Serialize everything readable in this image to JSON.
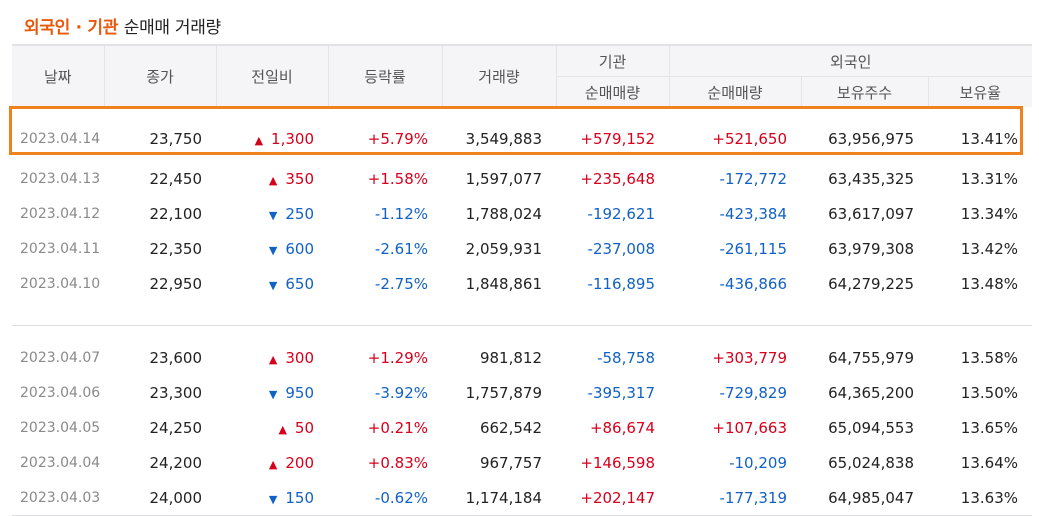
{
  "title": {
    "part1": "외국인 · 기관",
    "part2": "순매매 거래량"
  },
  "headers": {
    "date": "날짜",
    "close": "종가",
    "change": "전일비",
    "rate": "등락률",
    "volume": "거래량",
    "inst_group": "기관",
    "inst_net": "순매매량",
    "foreign_group": "외국인",
    "foreign_net": "순매매량",
    "foreign_hold": "보유주수",
    "foreign_ratio": "보유율"
  },
  "rows": [
    {
      "date": "2023.04.14",
      "close": "23,750",
      "dir": "up",
      "change": "1,300",
      "rate": "+5.79%",
      "volume": "3,549,883",
      "inst": "+579,152",
      "foreign": "+521,650",
      "hold": "63,956,975",
      "ratio": "13.41%"
    },
    {
      "date": "2023.04.13",
      "close": "22,450",
      "dir": "up",
      "change": "350",
      "rate": "+1.58%",
      "volume": "1,597,077",
      "inst": "+235,648",
      "foreign": "-172,772",
      "hold": "63,435,325",
      "ratio": "13.31%"
    },
    {
      "date": "2023.04.12",
      "close": "22,100",
      "dir": "down",
      "change": "250",
      "rate": "-1.12%",
      "volume": "1,788,024",
      "inst": "-192,621",
      "foreign": "-423,384",
      "hold": "63,617,097",
      "ratio": "13.34%"
    },
    {
      "date": "2023.04.11",
      "close": "22,350",
      "dir": "down",
      "change": "600",
      "rate": "-2.61%",
      "volume": "2,059,931",
      "inst": "-237,008",
      "foreign": "-261,115",
      "hold": "63,979,308",
      "ratio": "13.42%"
    },
    {
      "date": "2023.04.10",
      "close": "22,950",
      "dir": "down",
      "change": "650",
      "rate": "-2.75%",
      "volume": "1,848,861",
      "inst": "-116,895",
      "foreign": "-436,866",
      "hold": "64,279,225",
      "ratio": "13.48%"
    },
    {
      "date": "2023.04.07",
      "close": "23,600",
      "dir": "up",
      "change": "300",
      "rate": "+1.29%",
      "volume": "981,812",
      "inst": "-58,758",
      "foreign": "+303,779",
      "hold": "64,755,979",
      "ratio": "13.58%"
    },
    {
      "date": "2023.04.06",
      "close": "23,300",
      "dir": "down",
      "change": "950",
      "rate": "-3.92%",
      "volume": "1,757,879",
      "inst": "-395,317",
      "foreign": "-729,829",
      "hold": "64,365,200",
      "ratio": "13.50%"
    },
    {
      "date": "2023.04.05",
      "close": "24,250",
      "dir": "up",
      "change": "50",
      "rate": "+0.21%",
      "volume": "662,542",
      "inst": "+86,674",
      "foreign": "+107,663",
      "hold": "65,094,553",
      "ratio": "13.65%"
    },
    {
      "date": "2023.04.04",
      "close": "24,200",
      "dir": "up",
      "change": "200",
      "rate": "+0.83%",
      "volume": "967,757",
      "inst": "+146,598",
      "foreign": "-10,209",
      "hold": "65,024,838",
      "ratio": "13.64%"
    },
    {
      "date": "2023.04.03",
      "close": "24,000",
      "dir": "down",
      "change": "150",
      "rate": "-0.62%",
      "volume": "1,174,184",
      "inst": "+202,147",
      "foreign": "-177,319",
      "hold": "64,985,047",
      "ratio": "13.63%"
    }
  ],
  "icons": {
    "up": "▲",
    "down": "▼"
  },
  "colors": {
    "up": "#d6001c",
    "down": "#1261c4",
    "highlight": "#f0821e",
    "title_accent": "#e8590c"
  }
}
